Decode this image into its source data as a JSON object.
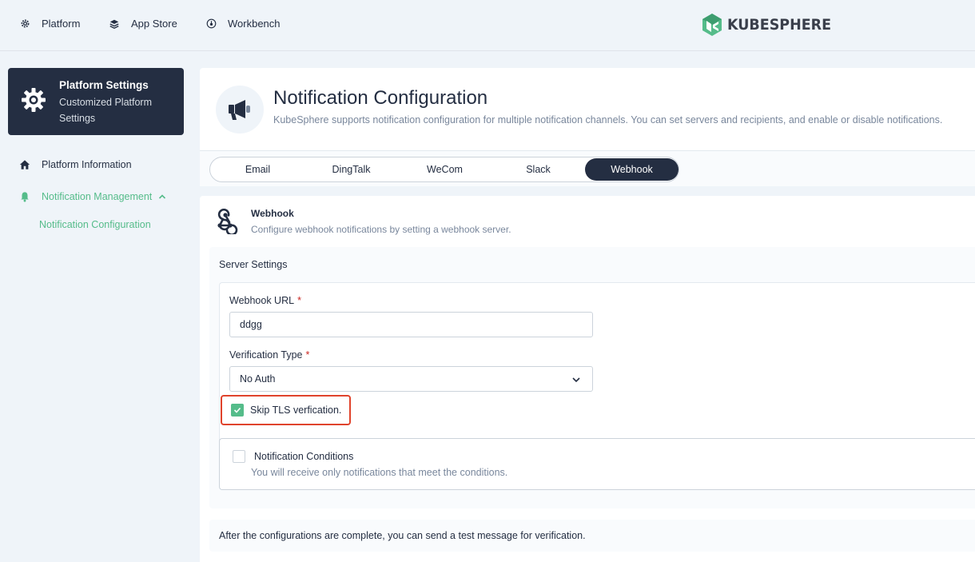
{
  "topnav": {
    "items": [
      {
        "label": "Platform",
        "icon": "gear-icon"
      },
      {
        "label": "App Store",
        "icon": "layers-icon"
      },
      {
        "label": "Workbench",
        "icon": "dashboard-icon"
      }
    ],
    "logo_text": "KUBESPHERE"
  },
  "sidebar": {
    "card_title": "Platform Settings",
    "card_subtitle": "Customized Platform Settings",
    "items": [
      {
        "label": "Platform Information",
        "icon": "home-icon"
      },
      {
        "label": "Notification Management",
        "icon": "bell-icon",
        "expanded": true
      }
    ],
    "subitem": "Notification Configuration"
  },
  "header": {
    "title": "Notification Configuration",
    "description": "KubeSphere supports notification configuration for multiple notification channels. You can set servers and recipients, and enable or disable notifications."
  },
  "tabs": [
    "Email",
    "DingTalk",
    "WeCom",
    "Slack",
    "Webhook"
  ],
  "active_tab": "Webhook",
  "webhook": {
    "title": "Webhook",
    "description": "Configure webhook notifications by setting a webhook server.",
    "server_settings_title": "Server Settings",
    "url_label": "Webhook URL",
    "url_value": "ddgg",
    "verification_label": "Verification Type",
    "verification_value": "No Auth",
    "required_mark": "*",
    "skip_tls_label": "Skip TLS verfication.",
    "skip_tls_checked": true
  },
  "conditions": {
    "title": "Notification Conditions",
    "description": "You will receive only notifications that meet the conditions.",
    "checked": false
  },
  "footer_note": "After the configurations are complete, you can send a test message for verification.",
  "colors": {
    "accent_green": "#55bc8a",
    "dark": "#242e42",
    "highlight_red": "#e0432c"
  }
}
